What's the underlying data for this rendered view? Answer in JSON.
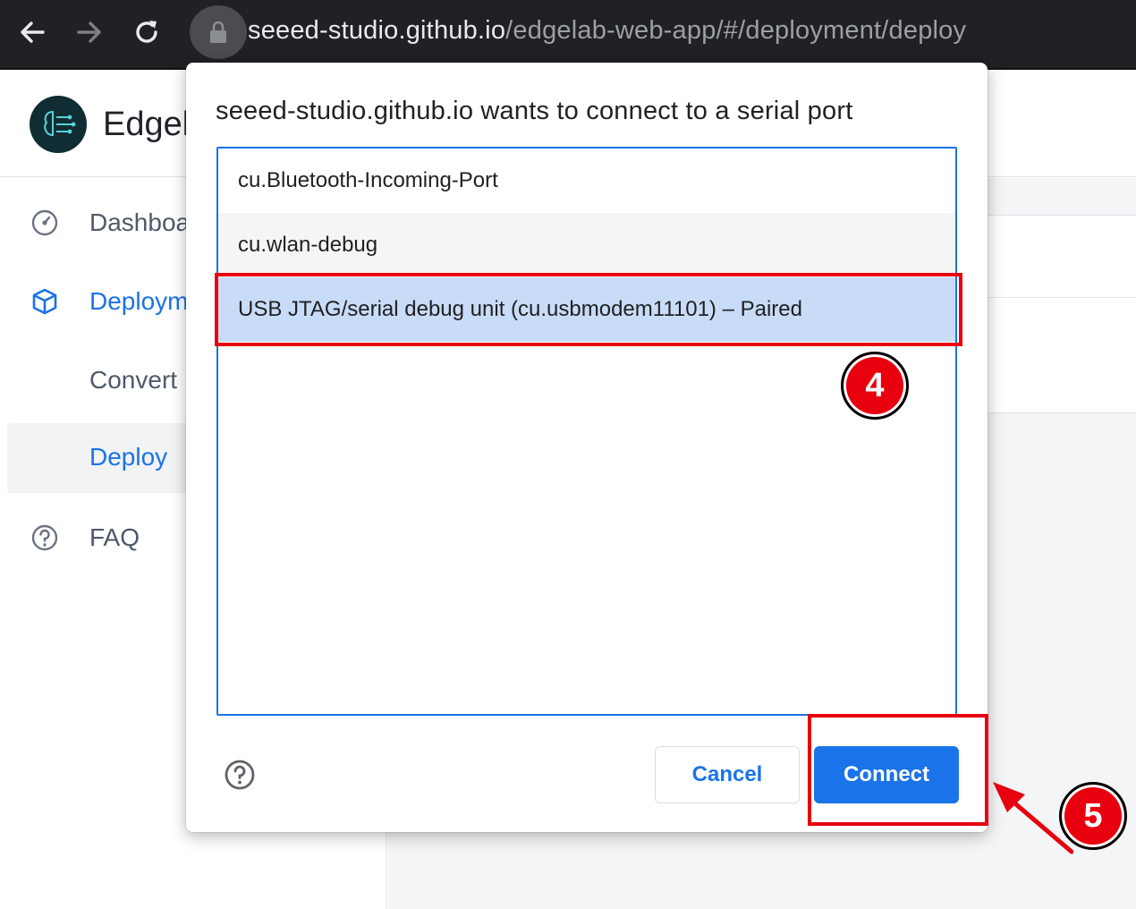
{
  "browser": {
    "url_host": "seeed-studio.github.io",
    "url_path": "/edgelab-web-app/#/deployment/deploy",
    "icons": [
      "back-arrow-icon",
      "forward-arrow-icon",
      "reload-icon",
      "lock-icon"
    ]
  },
  "app": {
    "title": "Edgel"
  },
  "sidebar": {
    "items": [
      {
        "label": "Dashboa",
        "icon": "dashboard-gauge-icon"
      },
      {
        "label": "Deploym",
        "icon": "cube-icon"
      },
      {
        "label": "Convert"
      },
      {
        "label": "Deploy"
      },
      {
        "label": "FAQ",
        "icon": "question-circle-icon"
      }
    ]
  },
  "dialog": {
    "title": "seeed-studio.github.io wants to connect to a serial port",
    "ports": [
      "cu.Bluetooth-Incoming-Port",
      "cu.wlan-debug",
      "USB JTAG/serial debug unit (cu.usbmodem11101) – Paired"
    ],
    "selected_index": 2,
    "cancel_label": "Cancel",
    "connect_label": "Connect"
  },
  "annotations": {
    "step4": "4",
    "step5": "5",
    "highlight_color": "#e8000f"
  },
  "colors": {
    "accent": "#1a73e8",
    "toolbar": "#202124",
    "selected_row": "#c9dcf7"
  }
}
